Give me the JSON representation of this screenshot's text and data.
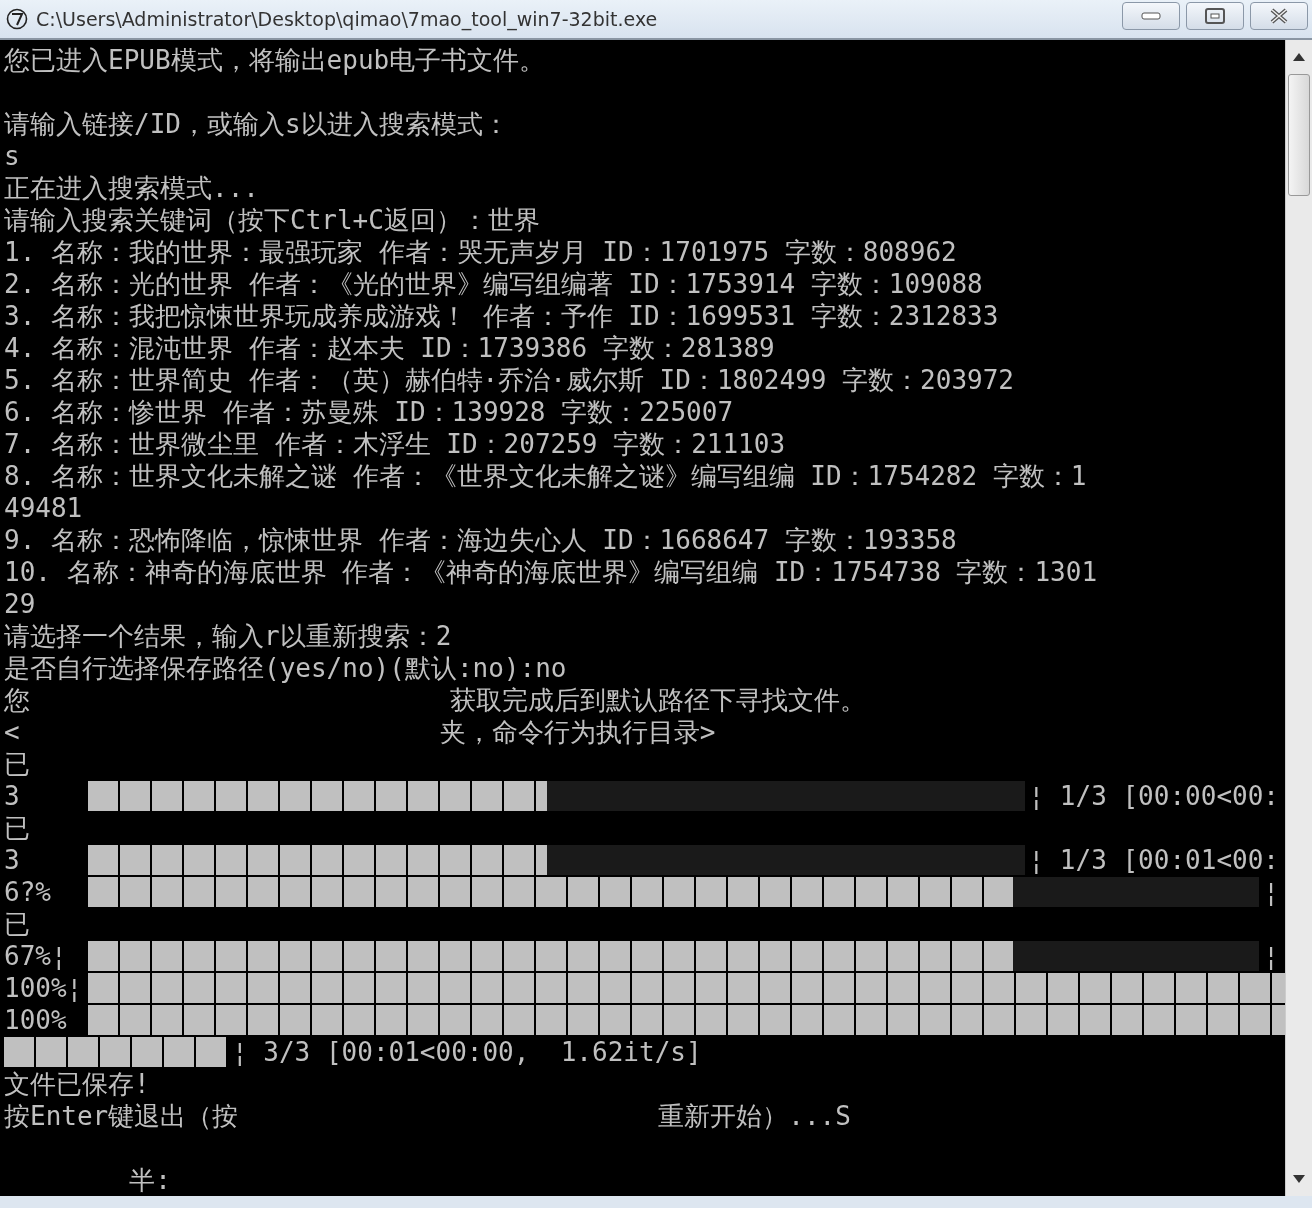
{
  "window": {
    "title": "C:\\Users\\Administrator\\Desktop\\qimao\\7mao_tool_win7-32bit.exe"
  },
  "console": {
    "lines": [
      {
        "kind": "text",
        "parts": [
          "您已进入EPUB模式，将输出epub电子书文件。"
        ]
      },
      {
        "kind": "blank"
      },
      {
        "kind": "text",
        "parts": [
          "请输入链接/ID，或输入s以进入搜索模式："
        ]
      },
      {
        "kind": "text",
        "parts": [
          "s"
        ]
      },
      {
        "kind": "text",
        "parts": [
          "正在进入搜索模式..."
        ]
      },
      {
        "kind": "text",
        "parts": [
          "请输入搜索关键词（按下Ctrl+C返回）：世界"
        ]
      },
      {
        "kind": "text",
        "parts": [
          "1. 名称：我的世界：最强玩家 作者：哭无声岁月 ID：1701975 字数：808962"
        ]
      },
      {
        "kind": "text",
        "parts": [
          "2. 名称：光的世界 作者：《光的世界》编写组编著 ID：1753914 字数：109088"
        ]
      },
      {
        "kind": "text",
        "parts": [
          "3. 名称：我把惊悚世界玩成养成游戏！ 作者：予作 ID：1699531 字数：2312833"
        ]
      },
      {
        "kind": "text",
        "parts": [
          "4. 名称：混沌世界 作者：赵本夫 ID：1739386 字数：281389"
        ]
      },
      {
        "kind": "text",
        "parts": [
          "5. 名称：世界简史 作者：（英）赫伯特·乔治·威尔斯 ID：1802499 字数：203972"
        ]
      },
      {
        "kind": "text",
        "parts": [
          "6. 名称：惨世界 作者：苏曼殊 ID：139928 字数：225007"
        ]
      },
      {
        "kind": "text",
        "parts": [
          "7. 名称：世界微尘里 作者：木浮生 ID：207259 字数：211103"
        ]
      },
      {
        "kind": "text",
        "parts": [
          "8. 名称：世界文化未解之谜 作者：《世界文化未解之谜》编写组编 ID：1754282 字数：1"
        ]
      },
      {
        "kind": "text",
        "parts": [
          "49481"
        ]
      },
      {
        "kind": "text",
        "parts": [
          "9. 名称：恐怖降临，惊悚世界 作者：海边失心人 ID：1668647 字数：193358"
        ]
      },
      {
        "kind": "text",
        "parts": [
          "10. 名称：神奇的海底世界 作者：《神奇的海底世界》编写组编 ID：1754738 字数：1301"
        ]
      },
      {
        "kind": "text",
        "parts": [
          "29"
        ]
      },
      {
        "kind": "text",
        "parts": [
          "请选择一个结果，输入r以重新搜索：2"
        ]
      },
      {
        "kind": "text",
        "parts": [
          "是否自行选择保存路径(yes/no)(默认:no):no"
        ]
      },
      {
        "kind": "text",
        "parts": [
          "您",
          "获取完成后到默认路径下寻找文件。"
        ]
      },
      {
        "kind": "text",
        "parts": [
          "<",
          "夹，命令行为执行目录>"
        ]
      },
      {
        "kind": "text",
        "parts": [
          "已"
        ]
      },
      {
        "kind": "progress",
        "prefix": "3",
        "level": 0.49,
        "suffix": "¦ 1/3 [00:00<00:"
      },
      {
        "kind": "text",
        "parts": [
          "已"
        ]
      },
      {
        "kind": "progress",
        "prefix": "3",
        "level": 0.49,
        "suffix": "¦ 1/3 [00:01<00:"
      },
      {
        "kind": "progress",
        "prefix": "6?%",
        "level": 0.79,
        "suffix": "¦"
      },
      {
        "kind": "text",
        "parts": [
          "已"
        ]
      },
      {
        "kind": "progress",
        "prefix": "67%¦",
        "level": 0.79,
        "suffix": "¦"
      },
      {
        "kind": "progress",
        "prefix": "100%¦",
        "level": 1
      },
      {
        "kind": "progress",
        "prefix": "100%",
        "level": 1
      },
      {
        "kind": "tail",
        "level": 1,
        "parts": [
          "¦ 3/3 [00:01<00:00,  1.62it/s]"
        ]
      },
      {
        "kind": "text",
        "parts": [
          "文件已保存!"
        ]
      },
      {
        "kind": "text",
        "parts": [
          "按Enter键退出（按",
          "重新开始）...S"
        ]
      },
      {
        "kind": "blank"
      },
      {
        "kind": "text",
        "parts": [
          "        半:"
        ]
      }
    ]
  }
}
